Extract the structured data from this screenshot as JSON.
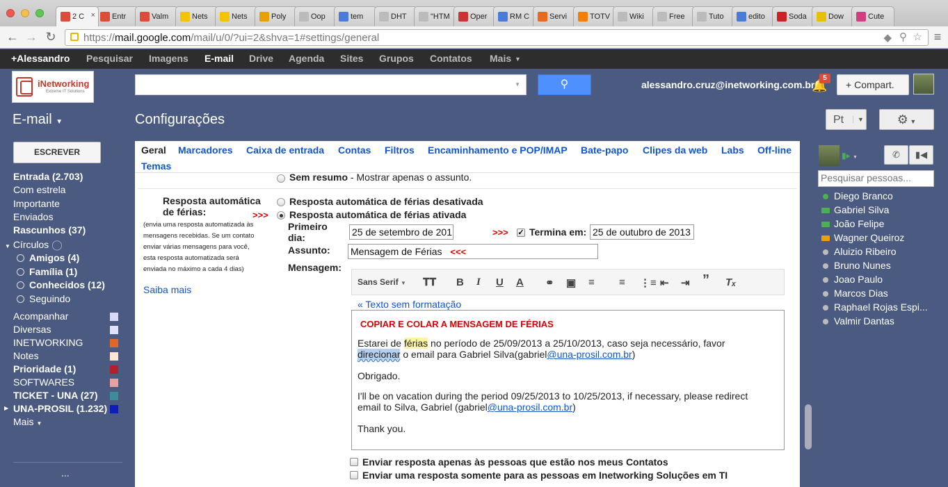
{
  "browser": {
    "tabs": [
      {
        "label": "2 C",
        "favicon": "gmail",
        "color": "#dd4b39",
        "active": true
      },
      {
        "label": "Entr",
        "favicon": "gmail",
        "color": "#dd4b39"
      },
      {
        "label": "Valm",
        "favicon": "gmail-2",
        "color": "#dd4b39"
      },
      {
        "label": "Nets",
        "favicon": "netsuite",
        "color": "#f5c400"
      },
      {
        "label": "Nets",
        "favicon": "netsuite",
        "color": "#f5c400"
      },
      {
        "label": "Poly",
        "favicon": "at-sign",
        "color": "#e6a000"
      },
      {
        "label": "Oop",
        "favicon": "page",
        "color": "#bbbbbb"
      },
      {
        "label": "tem",
        "favicon": "google",
        "color": "#4a7bd9"
      },
      {
        "label": "DHT",
        "favicon": "page",
        "color": "#bbbbbb"
      },
      {
        "label": "\"HTM",
        "favicon": "page",
        "color": "#bbbbbb"
      },
      {
        "label": "Oper",
        "favicon": "opera",
        "color": "#cc3333"
      },
      {
        "label": "RM C",
        "favicon": "google",
        "color": "#4a7bd9"
      },
      {
        "label": "Servi",
        "favicon": "fire",
        "color": "#e86a1c"
      },
      {
        "label": "TOTV",
        "favicon": "blogger",
        "color": "#f57d00"
      },
      {
        "label": "Wiki",
        "favicon": "page",
        "color": "#bbbbbb"
      },
      {
        "label": "Free",
        "favicon": "page",
        "color": "#bbbbbb"
      },
      {
        "label": "Tuto",
        "favicon": "page",
        "color": "#bbbbbb"
      },
      {
        "label": "edito",
        "favicon": "google",
        "color": "#4a7bd9"
      },
      {
        "label": "Soda",
        "favicon": "s",
        "color": "#cc2222"
      },
      {
        "label": "Dow",
        "favicon": "sun",
        "color": "#e8c000"
      },
      {
        "label": "Cute",
        "favicon": "cute",
        "color": "#d04080"
      }
    ],
    "url_scheme": "https://",
    "url_host": "mail.google.com",
    "url_path": "/mail/u/0/?ui=2&shva=1#settings/general"
  },
  "gbar": {
    "items": [
      "+Alessandro",
      "Pesquisar",
      "Imagens",
      "E-mail",
      "Drive",
      "Agenda",
      "Sites",
      "Grupos",
      "Contatos",
      "Mais"
    ],
    "active": "E-mail"
  },
  "header": {
    "logo_text": "iNetworking",
    "logo_sub": "Extreme IT Solutions",
    "account": "alessandro.cruz@inetworking.com.br",
    "notifications": "5",
    "share_label": "Compart."
  },
  "title_bar": {
    "app": "E-mail",
    "page": "Configurações",
    "lang": "Pt"
  },
  "sidebar": {
    "compose": "ESCREVER",
    "items": [
      {
        "label": "Entrada (2.703)",
        "bold": true
      },
      {
        "label": "Com estrela",
        "bold": false
      },
      {
        "label": "Importante",
        "bold": false
      },
      {
        "label": "Enviados",
        "bold": false
      },
      {
        "label": "Rascunhos (37)",
        "bold": true
      }
    ],
    "circles_label": "Círculos",
    "circles": [
      {
        "label": "Amigos (4)",
        "bold": true
      },
      {
        "label": "Família (1)",
        "bold": true
      },
      {
        "label": "Conhecidos (12)",
        "bold": true
      },
      {
        "label": "Seguindo",
        "bold": false
      }
    ],
    "labels": [
      {
        "label": "Acompanhar",
        "bold": false,
        "color": "#d8d8f8"
      },
      {
        "label": "Diversas",
        "bold": false,
        "color": "#e0e0f8"
      },
      {
        "label": "INETWORKING",
        "bold": false,
        "color": "#e0662a"
      },
      {
        "label": "Notes",
        "bold": false,
        "color": "#fde6d2"
      },
      {
        "label": "Prioridade (1)",
        "bold": true,
        "color": "#b3202b"
      },
      {
        "label": "SOFTWARES",
        "bold": false,
        "color": "#e8a0a0"
      },
      {
        "label": "TICKET - UNA (27)",
        "bold": true,
        "color": "#3d8c9a"
      },
      {
        "label": "UNA-PROSIL (1.232)",
        "bold": true,
        "color": "#0b1fb8"
      }
    ],
    "more": "Mais",
    "dots": "..."
  },
  "settings_tabs": {
    "items": [
      "Geral",
      "Marcadores",
      "Caixa de entrada",
      "Contas",
      "Filtros",
      "Encaminhamento e POP/IMAP",
      "Bate-papo",
      "Clipes da web",
      "Labs",
      "Off-line",
      "Temas"
    ],
    "selected": "Geral"
  },
  "vacation": {
    "prev_option_bold": "Sem resumo",
    "prev_option_rest": " - Mostrar apenas o assunto.",
    "section_title": "Resposta automática de férias:",
    "section_desc": "(envia uma resposta automatizada às mensagens recebidas. Se um contato enviar várias mensagens para você, esta resposta automatizada será enviada no máximo a cada 4 dias)",
    "learn_more": "Saiba mais",
    "arrows": ">>>",
    "arrows_left": "<<<",
    "off_label": "Resposta automática de férias desativada",
    "on_label": "Resposta automática de férias ativada",
    "first_day_label": "Primeiro dia:",
    "first_day_value": "25 de setembro de 201",
    "ends_label": "Termina em:",
    "ends_checked": true,
    "ends_value": "25 de outubro de 2013",
    "subject_label": "Assunto:",
    "subject_value": "Mensagem de Férias",
    "message_label": "Mensagem:",
    "font_select": "Sans Serif",
    "plain_text_link": "« Texto sem formatação",
    "body_heading": "COPIAR E COLAR A MENSAGEM DE FÉRIAS",
    "body_p1_a": "Estarei de ",
    "body_p1_hl": "férias",
    "body_p1_b": " no período de 25/09/2013 a 25/10/2013, caso seja necessário, favor",
    "body_p1_sel": "direcionar",
    "body_p1_c": " o email para Gabriel Silva(gabriel",
    "body_p1_link": "@una-prosil.com.br",
    "body_p1_end": ")",
    "body_p2": "Obrigado.",
    "body_p3_a": "I'll be on vacation during the period 09/25/2013 to 10/25/2013, if necessary, please redirect",
    "body_p3_b": "email to Silva, Gabriel (gabriel",
    "body_p3_link": "@una-prosil.com.br",
    "body_p3_end": ")",
    "body_p4": "Thank you.",
    "contacts_only": "Enviar resposta apenas às pessoas que estão nos meus Contatos",
    "domain_only": "Enviar uma resposta somente para as pessoas em Inetworking Soluções em TI"
  },
  "chat": {
    "search_placeholder": "Pesquisar pessoas...",
    "people": [
      {
        "name": "Diego Branco",
        "status": "available",
        "color": "#4caf50"
      },
      {
        "name": "Gabriel Silva",
        "status": "video",
        "color": "#4caf50"
      },
      {
        "name": "João Felipe",
        "status": "video",
        "color": "#4caf50"
      },
      {
        "name": "Wagner Queiroz",
        "status": "video-away",
        "color": "#f39c12"
      },
      {
        "name": "Aluizio Ribeiro",
        "status": "offline",
        "color": "#bbbbbb"
      },
      {
        "name": "Bruno Nunes",
        "status": "offline",
        "color": "#bbbbbb"
      },
      {
        "name": "Joao Paulo",
        "status": "offline",
        "color": "#bbbbbb"
      },
      {
        "name": "Marcos Dias",
        "status": "offline",
        "color": "#bbbbbb"
      },
      {
        "name": "Raphael Rojas Espi...",
        "status": "offline",
        "color": "#bbbbbb"
      },
      {
        "name": "Valmir Dantas",
        "status": "offline",
        "color": "#bbbbbb"
      }
    ]
  }
}
